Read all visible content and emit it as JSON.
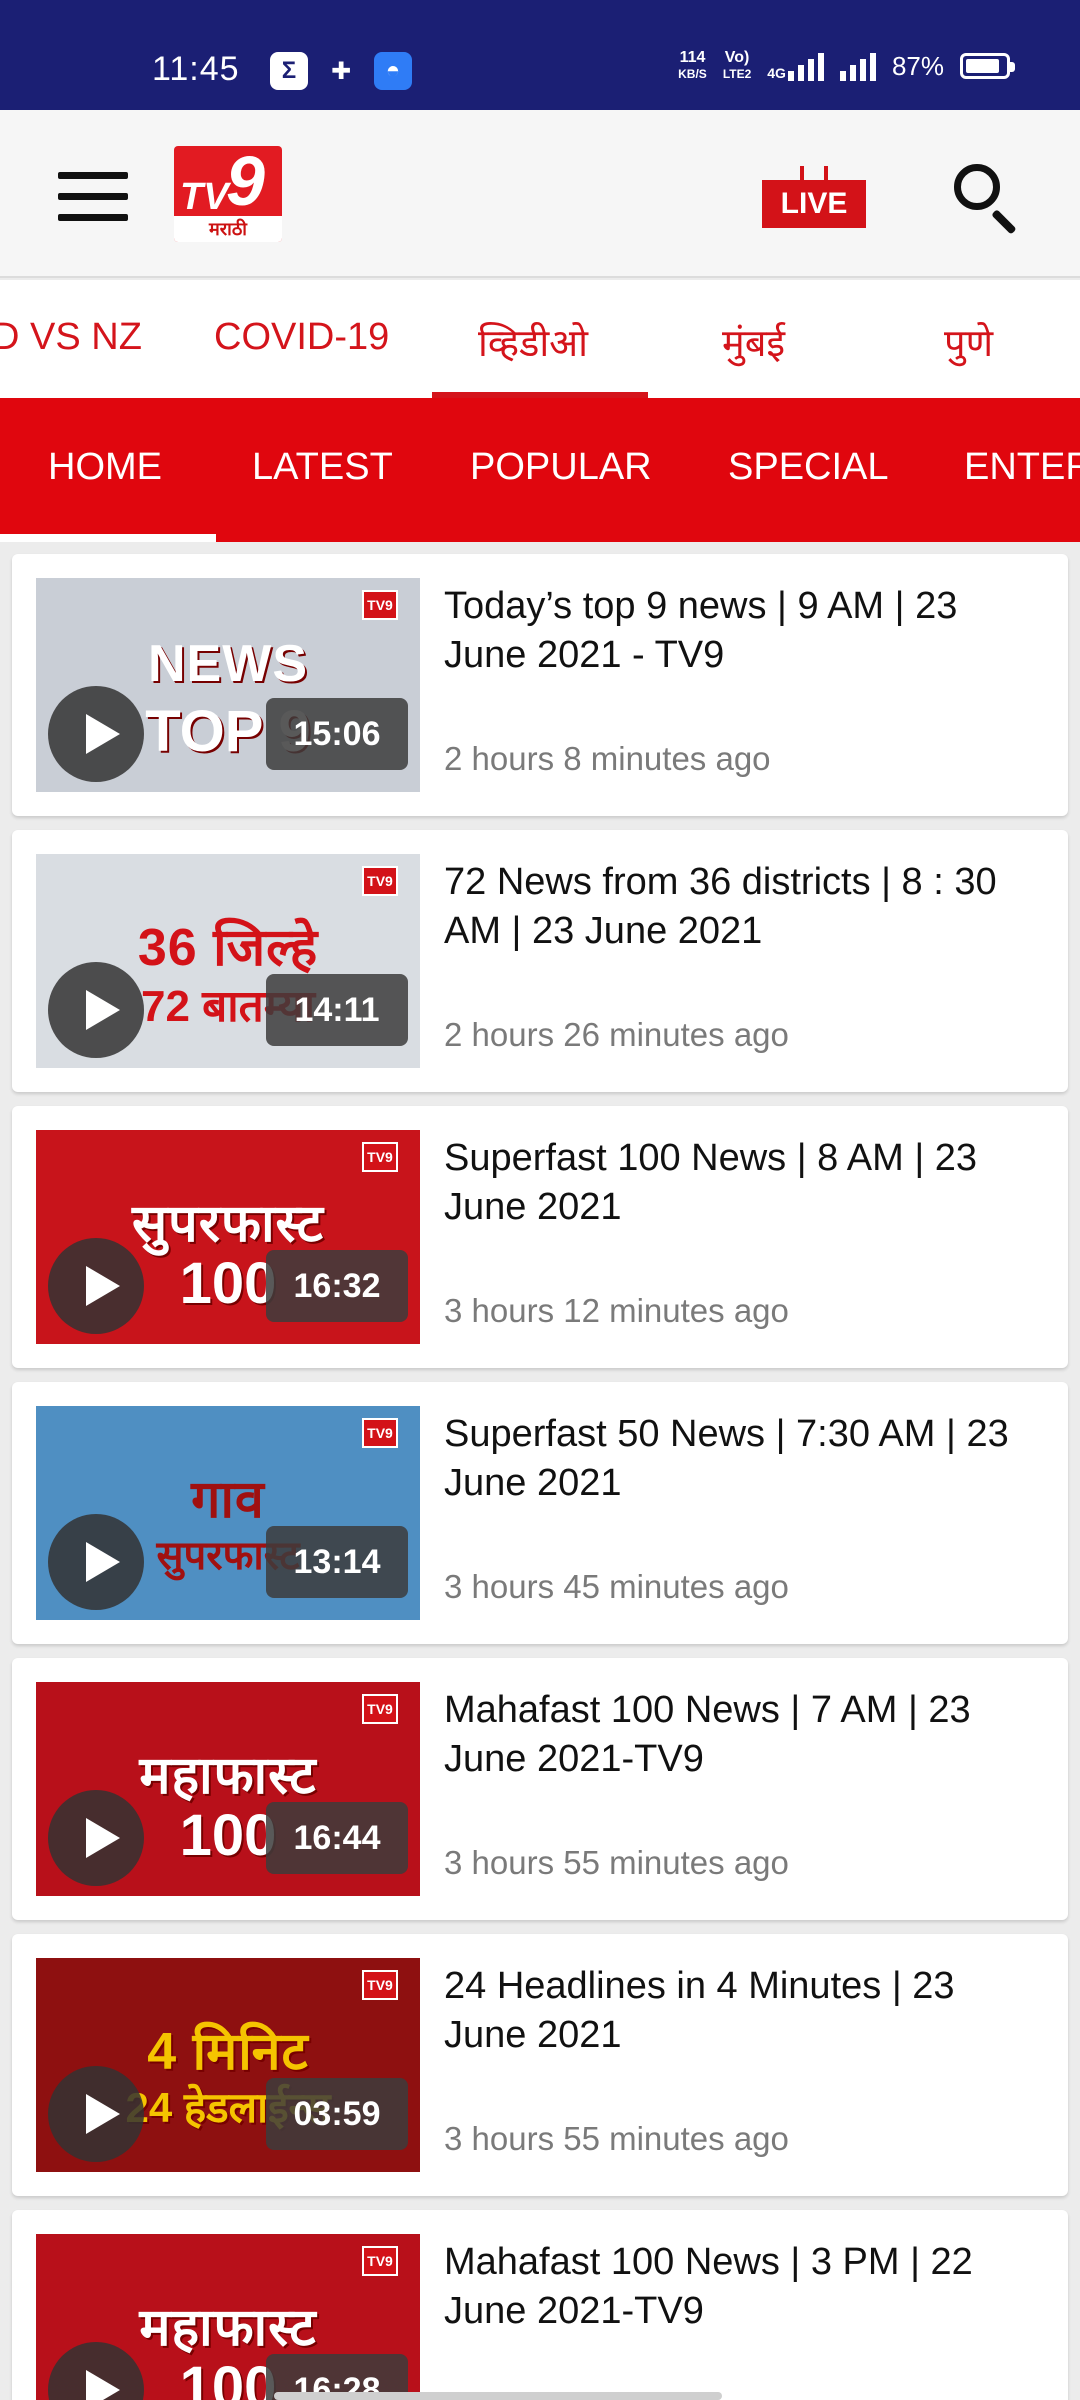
{
  "status_bar": {
    "time": "11:45",
    "net_speed_top": "114",
    "net_speed_bottom": "KB/S",
    "volte_top": "Vo)",
    "volte_bottom": "LTE2",
    "network": "4G",
    "battery": "87%",
    "battery_level": 0.87
  },
  "app_bar": {
    "logo_tv": "TV",
    "logo_nine": "9",
    "logo_sub": "मराठी",
    "live_label": "LIVE"
  },
  "categories": [
    "D VS NZ",
    "COVID-19",
    "व्हिडीओ",
    "मुंबई",
    "पुणे"
  ],
  "tabs": [
    "HOME",
    "LATEST",
    "POPULAR",
    "SPECIAL",
    "ENTER"
  ],
  "videos": [
    {
      "title": "Today’s top 9 news | 9 AM | 23 June 2021 - TV9",
      "time": "2 hours 8 minutes ago",
      "duration": "15:06",
      "thumb_title": "NEWS",
      "thumb_sub": "TOP 9",
      "thumb_color": "#c9ced6"
    },
    {
      "title": "72 News from 36 districts |  8 : 30 AM | 23 June 2021",
      "time": "2 hours 26 minutes ago",
      "duration": "14:11",
      "thumb_title": "36 जिल्हे",
      "thumb_sub": "72 बातम्या",
      "thumb_color": "#d9dde2"
    },
    {
      "title": "Superfast 100 News | 8 AM | 23 June 2021",
      "time": "3 hours 12 minutes ago",
      "duration": "16:32",
      "thumb_title": "सुपरफास्ट",
      "thumb_sub": "100",
      "thumb_color": "#c8141b"
    },
    {
      "title": "Superfast 50 News | 7:30 AM | 23 June 2021",
      "time": "3 hours 45 minutes ago",
      "duration": "13:14",
      "thumb_title": "गाव",
      "thumb_sub": "सुपरफास्ट",
      "thumb_color": "#4f8fc2"
    },
    {
      "title": "Mahafast 100 News |  7 AM | 23 June 2021-TV9",
      "time": "3 hours 55 minutes ago",
      "duration": "16:44",
      "thumb_title": "महाफास्ट",
      "thumb_sub": "100",
      "thumb_color": "#b8101a"
    },
    {
      "title": "24 Headlines in 4 Minutes | 23 June 2021",
      "time": "3 hours 55 minutes ago",
      "duration": "03:59",
      "thumb_title": "4 मिनिट",
      "thumb_sub": "24 हेडलाईन्स",
      "thumb_color": "#8e1010"
    },
    {
      "title": "Mahafast 100 News |  3 PM | 22 June 2021-TV9",
      "time": "",
      "duration": "16:28",
      "thumb_title": "महाफास्ट",
      "thumb_sub": "100",
      "thumb_color": "#b8101a"
    }
  ]
}
